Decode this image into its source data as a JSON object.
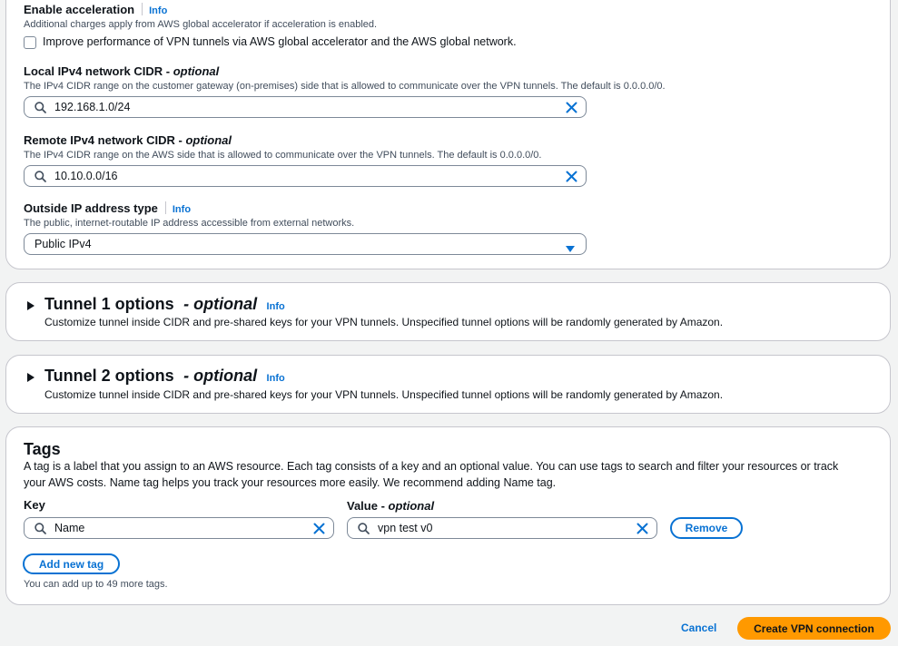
{
  "vpn_options": {
    "acceleration": {
      "label": "Enable acceleration",
      "info": "Info",
      "description": "Additional charges apply from AWS global accelerator if acceleration is enabled.",
      "checkbox_label": "Improve performance of VPN tunnels via AWS global accelerator and the AWS global network.",
      "checked": false
    },
    "local_cidr": {
      "label": "Local IPv4 network CIDR - ",
      "optional": "optional",
      "description": "The IPv4 CIDR range on the customer gateway (on-premises) side that is allowed to communicate over the VPN tunnels. The default is 0.0.0.0/0.",
      "value": "192.168.1.0/24"
    },
    "remote_cidr": {
      "label": "Remote IPv4 network CIDR - ",
      "optional": "optional",
      "description": "The IPv4 CIDR range on the AWS side that is allowed to communicate over the VPN tunnels. The default is 0.0.0.0/0.",
      "value": "10.10.0.0/16"
    },
    "outside_ip": {
      "label": "Outside IP address type",
      "info": "Info",
      "description": "The public, internet-routable IP address accessible from external networks.",
      "value": "Public IPv4"
    }
  },
  "tunnel1": {
    "title": "Tunnel 1 options",
    "optional": "- optional",
    "info": "Info",
    "description": "Customize tunnel inside CIDR and pre-shared keys for your VPN tunnels. Unspecified tunnel options will be randomly generated by Amazon."
  },
  "tunnel2": {
    "title": "Tunnel 2 options",
    "optional": "- optional",
    "info": "Info",
    "description": "Customize tunnel inside CIDR and pre-shared keys for your VPN tunnels. Unspecified tunnel options will be randomly generated by Amazon."
  },
  "tags": {
    "title": "Tags",
    "description_line1": "A tag is a label that you assign to an AWS resource. Each tag consists of a key and an optional value. You can use tags to search and filter your resources or track",
    "description_line2": "your AWS costs. Name tag helps you track your resources more easily. We recommend adding Name tag.",
    "key_label": "Key",
    "value_label": "Value - ",
    "value_optional": "optional",
    "rows": [
      {
        "key": "Name",
        "value": "vpn test v0",
        "remove_label": "Remove"
      }
    ],
    "add_label": "Add new tag",
    "limit_text": "You can add up to 49 more tags."
  },
  "footer": {
    "cancel_label": "Cancel",
    "create_label": "Create VPN connection"
  },
  "colors": {
    "link": "#0972d3",
    "primary": "#ff9900",
    "border": "#7d8998"
  }
}
